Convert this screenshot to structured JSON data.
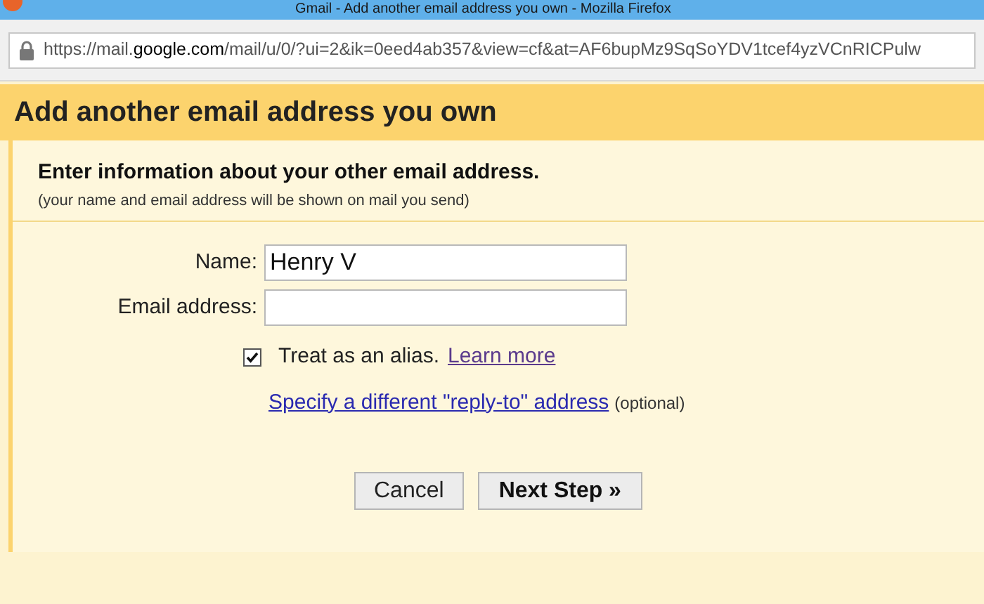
{
  "window": {
    "title": "Gmail - Add another email address you own - Mozilla Firefox"
  },
  "address_bar": {
    "url_prefix": "https://mail.",
    "url_domain": "google.com",
    "url_rest": "/mail/u/0/?ui=2&ik=0eed4ab357&view=cf&at=AF6bupMz9SqSoYDV1tcef4yzVCnRICPulw"
  },
  "dialog": {
    "title": "Add another email address you own",
    "heading": "Enter information about your other email address.",
    "subheading": "(your name and email address will be shown on mail you send)",
    "fields": [
      {
        "label": "Name:",
        "value": "Henry V"
      },
      {
        "label": "Email address:"
      }
    ],
    "alias": {
      "label": "Treat as an alias.",
      "checked": true,
      "link": "Learn more"
    },
    "reply_to": {
      "link": "Specify a different \"reply-to\" address",
      "note": "(optional)"
    },
    "buttons": [
      {
        "label": "Cancel",
        "primary": false
      },
      {
        "label": "Next Step »",
        "primary": true
      }
    ]
  }
}
